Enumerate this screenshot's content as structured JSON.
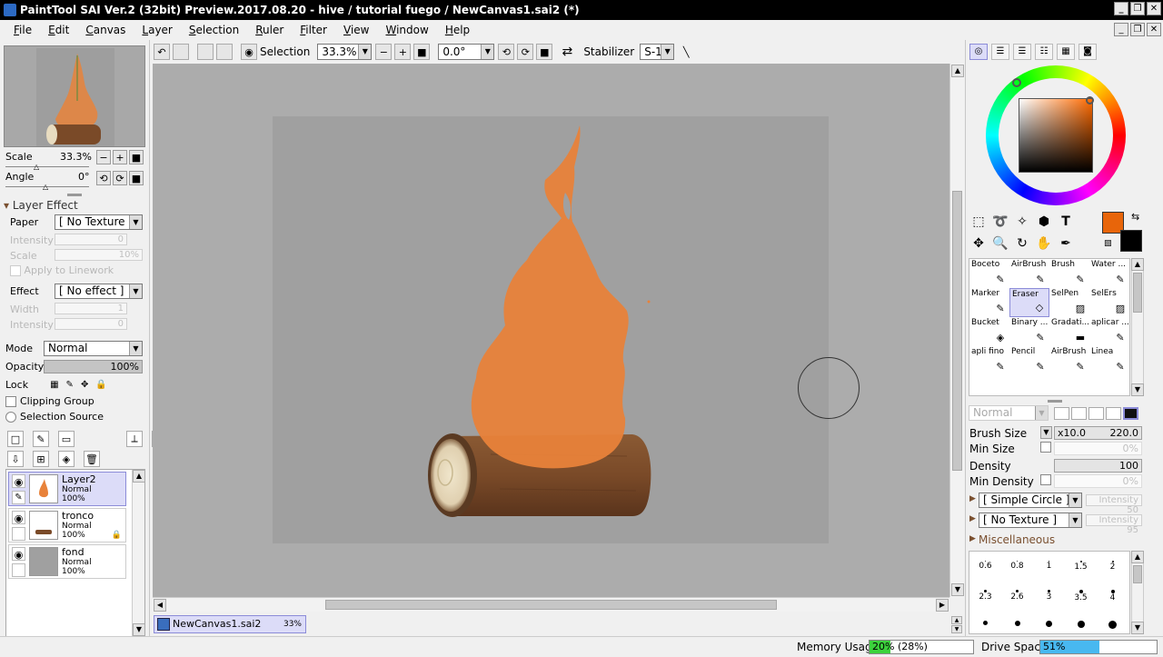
{
  "window": {
    "title": "PaintTool SAI Ver.2 (32bit) Preview.2017.08.20 - hive / tutorial fuego / NewCanvas1.sai2 (*)"
  },
  "menu": [
    "File",
    "Edit",
    "Canvas",
    "Layer",
    "Selection",
    "Ruler",
    "Filter",
    "View",
    "Window",
    "Help"
  ],
  "navigator": {
    "scale_label": "Scale",
    "scale_value": "33.3%",
    "angle_label": "Angle",
    "angle_value": "0°"
  },
  "layer_effect": {
    "header": "Layer Effect",
    "paper_label": "Paper",
    "paper_value": "[ No Texture ]",
    "intensity_label": "Intensity",
    "intensity_value": "0",
    "scale_label": "Scale",
    "scale_value": "10%",
    "apply_linework": "Apply to Linework",
    "effect_label": "Effect",
    "effect_value": "[ No effect ]",
    "width_label": "Width",
    "width_value": "1",
    "intensity2_label": "Intensity",
    "intensity2_value": "0"
  },
  "layer_props": {
    "mode_label": "Mode",
    "mode_value": "Normal",
    "opacity_label": "Opacity",
    "opacity_value": "100%",
    "lock_label": "Lock",
    "clipping_group": "Clipping Group",
    "selection_source": "Selection Source"
  },
  "layers": [
    {
      "name": "Layer2",
      "mode": "Normal",
      "opacity": "100%",
      "selected": true
    },
    {
      "name": "tronco",
      "mode": "Normal",
      "opacity": "100%",
      "selected": false
    },
    {
      "name": "fond",
      "mode": "Normal",
      "opacity": "100%",
      "selected": false
    }
  ],
  "toolbar": {
    "selection_label": "Selection",
    "zoom_value": "33.3%",
    "rotation_value": "0.0°",
    "stabilizer_label": "Stabilizer",
    "stabilizer_value": "S-1"
  },
  "document_tab": {
    "name": "NewCanvas1.sai2",
    "zoom": "33%"
  },
  "status": {
    "memory_label": "Memory Usage",
    "memory_value": "20% (28%)",
    "memory_fill": 0.2,
    "drive_label": "Drive Space",
    "drive_value": "51%",
    "drive_fill": 0.51
  },
  "colors": {
    "foreground": "#e8650a",
    "background": "#000000",
    "flame": "#e8823a"
  },
  "brushes": [
    {
      "name": "Boceto",
      "icon": "pencil-icon"
    },
    {
      "name": "AirBrush",
      "icon": "airbrush-icon"
    },
    {
      "name": "Brush",
      "icon": "brush-icon"
    },
    {
      "name": "Water ...",
      "icon": "water-brush-icon"
    },
    {
      "name": "Marker",
      "icon": "marker-icon"
    },
    {
      "name": "Eraser",
      "icon": "eraser-icon",
      "selected": true
    },
    {
      "name": "SelPen",
      "icon": "selpen-icon"
    },
    {
      "name": "SelErs",
      "icon": "selers-icon"
    },
    {
      "name": "Bucket",
      "icon": "bucket-icon"
    },
    {
      "name": "Binary ...",
      "icon": "binary-pen-icon"
    },
    {
      "name": "Gradati...",
      "icon": "gradation-icon"
    },
    {
      "name": "aplicar ...",
      "icon": "brush-icon"
    },
    {
      "name": "apli fino",
      "icon": "pen-icon"
    },
    {
      "name": "Pencil",
      "icon": "pencil-icon"
    },
    {
      "name": "AirBrush",
      "icon": "airbrush-icon"
    },
    {
      "name": "Linea",
      "icon": "pen-icon"
    }
  ],
  "brush_settings": {
    "blend_value": "Normal",
    "size_label": "Brush Size",
    "size_multiplier": "x10.0",
    "size_value": "220.0",
    "min_size_label": "Min Size",
    "min_size_value": "0%",
    "density_label": "Density",
    "density_value": "100",
    "min_density_label": "Min Density",
    "min_density_value": "0%",
    "shape_value": "[ Simple Circle ]",
    "shape_intensity": "Intensity 50",
    "texture_value": "[ No Texture ]",
    "texture_intensity": "Intensity 95",
    "misc_label": "Miscellaneous"
  },
  "brush_sizes": [
    "0.6",
    "0.8",
    "1",
    "1.5",
    "2",
    "2.3",
    "2.6",
    "3",
    "3.5",
    "4"
  ]
}
